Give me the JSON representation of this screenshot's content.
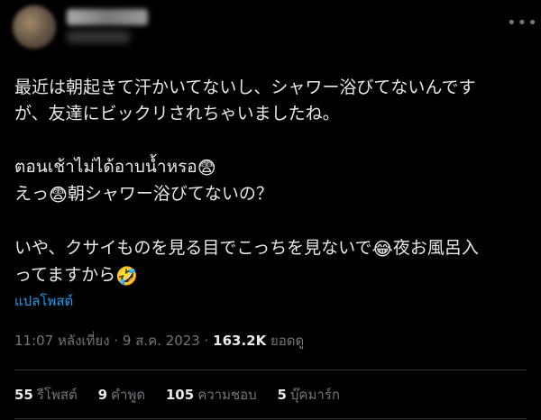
{
  "post": {
    "lines_para1": [
      "最近は朝起きて汗かいてないし、シャワー浴びてないんです",
      "が、友達にビックリされちゃいましたね。"
    ],
    "thai_line": "ตอนเช้าไม่ได้อาบน้ำหรอ",
    "line_question_before": "えっ",
    "line_question_after": "朝シャワー浴びてないの？",
    "line_last1_before": "いや、クサイものを見る目でこっちを見ないで",
    "line_last1_after": "夜お風呂入",
    "line_last2_before": "ってますから",
    "emoji_anxious": "😨",
    "emoji_laugh": "😂",
    "emoji_rofl": "🤣"
  },
  "translate_label": "แปลโพสต์",
  "meta": {
    "time": "11:07 หลังเที่ยง",
    "sep": " · ",
    "date": "9 ส.ค. 2023",
    "views_count": "163.2K",
    "views_label": "ยอดดู"
  },
  "stats": [
    {
      "count": "55",
      "label": "รีโพสต์"
    },
    {
      "count": "9",
      "label": "คำพูด"
    },
    {
      "count": "105",
      "label": "ความชอบ"
    },
    {
      "count": "5",
      "label": "บุ๊คมาร์ก"
    }
  ],
  "icons": {
    "more": "more-horizontal-icon"
  }
}
